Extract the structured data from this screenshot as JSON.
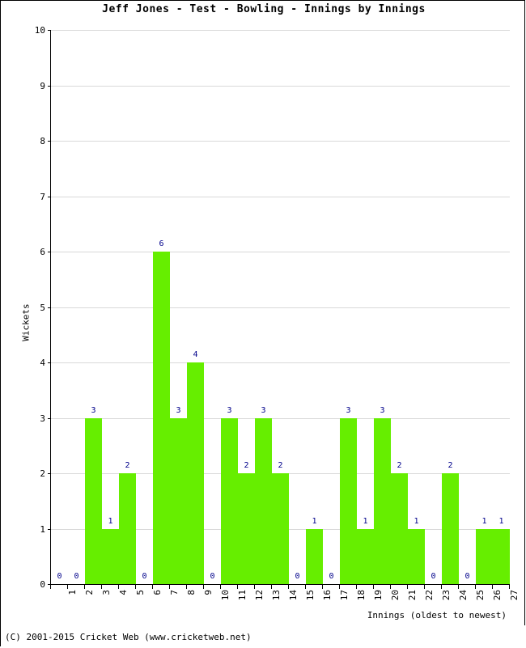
{
  "chart_data": {
    "type": "bar",
    "title": "Jeff Jones - Test - Bowling - Innings by Innings",
    "xlabel": "Innings (oldest to newest)",
    "ylabel": "Wickets",
    "ylim": [
      0,
      10
    ],
    "yticks": [
      0,
      1,
      2,
      3,
      4,
      5,
      6,
      7,
      8,
      9,
      10
    ],
    "grid": true,
    "legend": null,
    "categories": [
      "1",
      "2",
      "3",
      "4",
      "5",
      "6",
      "7",
      "8",
      "9",
      "10",
      "11",
      "12",
      "13",
      "14",
      "15",
      "16",
      "17",
      "18",
      "19",
      "20",
      "21",
      "22",
      "23",
      "24",
      "25",
      "26",
      "27"
    ],
    "values": [
      0,
      0,
      3,
      1,
      2,
      0,
      6,
      3,
      4,
      0,
      3,
      2,
      3,
      2,
      0,
      1,
      0,
      3,
      1,
      3,
      2,
      1,
      0,
      2,
      0,
      1,
      1
    ],
    "bar_color": "#66ee00",
    "value_label_color": "#00008b",
    "gridline_color": "#d9d9d9",
    "axis_color": "#000000"
  },
  "footer": {
    "copyright": "(C) 2001-2015 Cricket Web (www.cricketweb.net)"
  }
}
